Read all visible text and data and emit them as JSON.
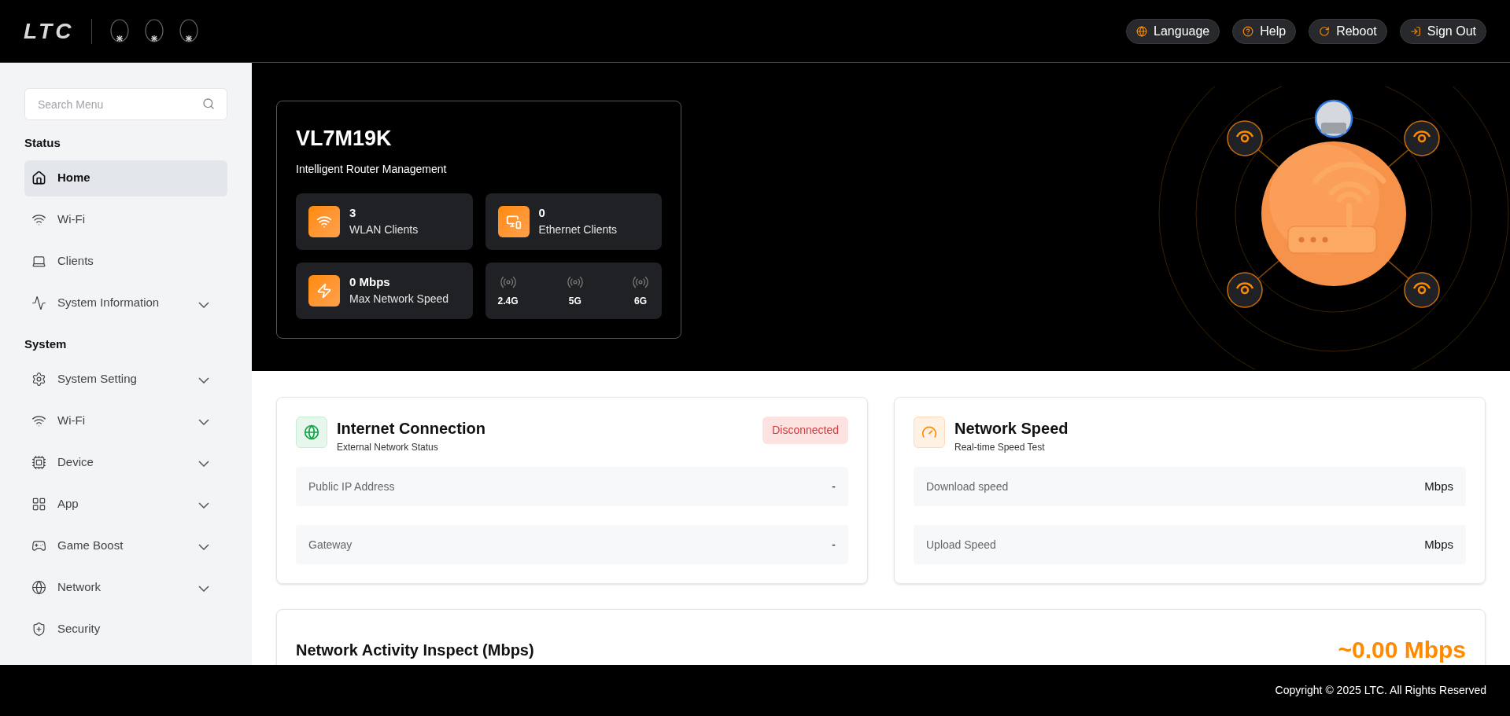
{
  "header": {
    "logo": "LTC",
    "actions": [
      {
        "label": "Language"
      },
      {
        "label": "Help"
      },
      {
        "label": "Reboot"
      },
      {
        "label": "Sign Out"
      }
    ]
  },
  "sidebar": {
    "search": {
      "placeholder": "Search Menu"
    },
    "sections": [
      {
        "title": "Status",
        "items": [
          {
            "label": "Home",
            "selected": true,
            "expandable": false
          },
          {
            "label": "Wi-Fi",
            "selected": false,
            "expandable": false
          },
          {
            "label": "Clients",
            "selected": false,
            "expandable": false
          },
          {
            "label": "System Information",
            "selected": false,
            "expandable": true
          }
        ]
      },
      {
        "title": "System",
        "items": [
          {
            "label": "System Setting",
            "selected": false,
            "expandable": true
          },
          {
            "label": "Wi-Fi",
            "selected": false,
            "expandable": true
          },
          {
            "label": "Device",
            "selected": false,
            "expandable": true
          },
          {
            "label": "App",
            "selected": false,
            "expandable": true
          },
          {
            "label": "Game Boost",
            "selected": false,
            "expandable": true
          },
          {
            "label": "Network",
            "selected": false,
            "expandable": true
          },
          {
            "label": "Security",
            "selected": false,
            "expandable": false
          }
        ]
      }
    ]
  },
  "hero": {
    "title": "VL7M19K",
    "subtitle": "Intelligent Router Management",
    "stats": [
      {
        "value": "3",
        "label": "WLAN Clients"
      },
      {
        "value": "0",
        "label": "Ethernet Clients"
      },
      {
        "value": "0 Mbps",
        "label": "Max Network Speed"
      }
    ],
    "bands": [
      "2.4G",
      "5G",
      "6G"
    ]
  },
  "internet": {
    "title": "Internet Connection",
    "subtitle": "External Network Status",
    "status": "Disconnected",
    "rows": [
      {
        "label": "Public IP Address",
        "value": "-"
      },
      {
        "label": "Gateway",
        "value": "-"
      }
    ]
  },
  "speed": {
    "title": "Network Speed",
    "subtitle": "Real-time Speed Test",
    "rows": [
      {
        "label": "Download speed",
        "value": "Mbps"
      },
      {
        "label": "Upload Speed",
        "value": "Mbps"
      }
    ]
  },
  "activity": {
    "title": "Network Activity Inspect (Mbps)",
    "value": "~0.00 Mbps"
  },
  "footer": {
    "copyright": "Copyright © 2025 LTC. All Rights Reserved"
  }
}
